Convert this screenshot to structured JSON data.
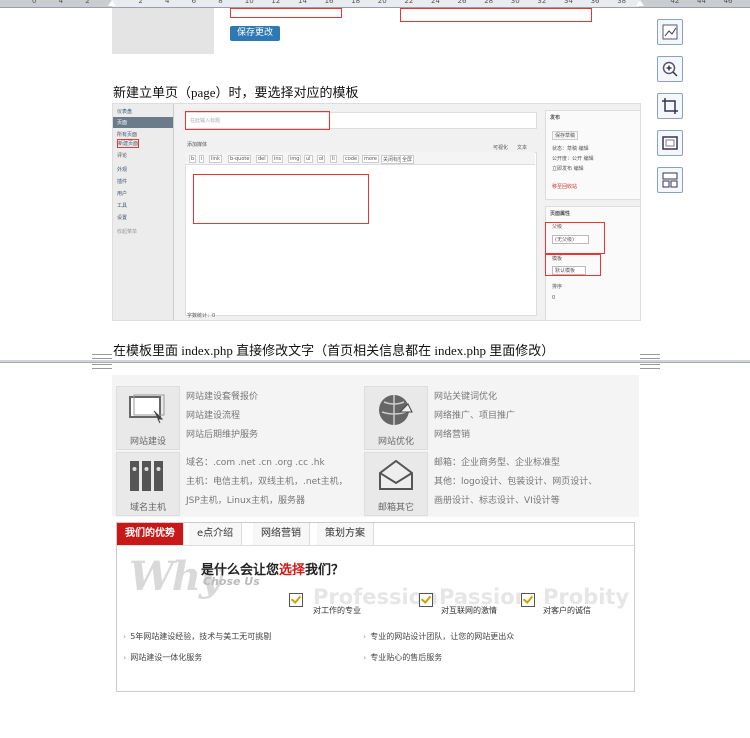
{
  "ruler": {
    "ticks": [
      "0",
      "4",
      "2",
      "",
      "2",
      "4",
      "6",
      "8",
      "10",
      "12",
      "14",
      "16",
      "18",
      "20",
      "22",
      "24",
      "26",
      "28",
      "30",
      "32",
      "34",
      "36",
      "38",
      "",
      "42",
      "44",
      "46"
    ]
  },
  "top_fragment": {
    "save_button": "保存更改"
  },
  "captions": {
    "template_caption": "新建立单页（page）时，要选择对应的模板",
    "index_caption_before": "在模板里面 index.php 直接修改文字（首页相关信息都在 index.php 里面修改）"
  },
  "admin": {
    "sidebar": [
      "仪表盘",
      "页面",
      "所有页面",
      "新建页面",
      "评论",
      "外观",
      "插件",
      "用户",
      "工具",
      "设置",
      "收起菜单"
    ],
    "title_placeholder": "在此输入标题",
    "media_button": "添加媒体",
    "editor_tabs": [
      "可视化",
      "文本"
    ],
    "toolbar": [
      "b",
      "i",
      "link",
      "b-quote",
      "del",
      "ins",
      "img",
      "ul",
      "ol",
      "li",
      "code",
      "more",
      "关闭标签",
      "全屏"
    ],
    "publish_title": "发布",
    "publish_items": [
      "保存草稿",
      "状态：草稿 编辑",
      "公开度：公开 编辑",
      "立即发布 编辑",
      "移至回收站"
    ],
    "attrs_title": "页面属性",
    "parent_label": "父级",
    "parent_value": "(无父级)",
    "template_label": "模板",
    "template_value": "默认模板",
    "order_label": "排序",
    "order_value": "0",
    "word_count": "字数统计：0"
  },
  "services": [
    {
      "icon_label": "网站建设",
      "lines": [
        "网站建设套餐报价",
        "网站建设流程",
        "网站后期维护服务"
      ]
    },
    {
      "icon_label": "网站优化",
      "lines": [
        "网站关键词优化",
        "网络推广、项目推广",
        "网络营销"
      ]
    },
    {
      "icon_label": "域名主机",
      "lines": [
        "域名：.com .net .cn .org .cc .hk",
        "主机：电信主机，双线主机，.net主机，",
        "JSP主机，Linux主机，服务器"
      ]
    },
    {
      "icon_label": "邮箱其它",
      "lines": [
        "邮箱：企业商务型、企业标准型",
        "其他：logo设计、包装设计、网页设计、",
        "画册设计、标志设计、VI设计等"
      ]
    }
  ],
  "tabs": [
    "我们的优势",
    "e点介绍",
    "网络营销",
    "策划方案"
  ],
  "why": {
    "big": "Why",
    "sub": "Chose Us",
    "title_a": "是什么会让您",
    "title_red": "选择",
    "title_b": "我们？",
    "ghost_words": [
      "Profession",
      "Passion",
      "Probity"
    ],
    "features": [
      "对工作的专业",
      "对互联网的激情",
      "对客户的诚信"
    ],
    "bullets": [
      "5年网站建设经验，技术与美工无可挑剔",
      "专业的网站设计团队，让您的网站更出众",
      "网站建设一体化服务",
      "专业贴心的售后服务"
    ]
  }
}
